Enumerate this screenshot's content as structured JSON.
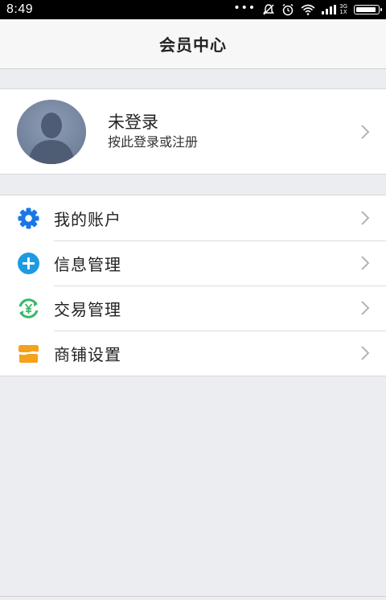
{
  "status_bar": {
    "time": "8:49",
    "network_top": "3G",
    "network_bottom": "1X",
    "icons": [
      "more-dots-icon",
      "silent-icon",
      "alarm-icon",
      "wifi-icon",
      "signal-icon",
      "battery-icon"
    ],
    "battery_level": 0.95
  },
  "header": {
    "title": "会员中心"
  },
  "profile": {
    "name": "未登录",
    "subtitle": "按此登录或注册",
    "avatar_icon": "default-avatar-icon",
    "chevron_icon": "chevron-right-icon"
  },
  "menu": {
    "items": [
      {
        "label": "我的账户",
        "icon": "gear-icon",
        "color": "#1a78e6"
      },
      {
        "label": "信息管理",
        "icon": "plus-circle-icon",
        "color": "#1e9be0"
      },
      {
        "label": "交易管理",
        "icon": "yen-exchange-icon",
        "color": "#35b86a"
      },
      {
        "label": "商铺设置",
        "icon": "store-icon",
        "color": "#f4a21c"
      }
    ]
  },
  "colors": {
    "background": "#ebedf0",
    "nav_background": "#f7f7f7",
    "card_background": "#ffffff",
    "chevron": "#b5b5b5"
  }
}
